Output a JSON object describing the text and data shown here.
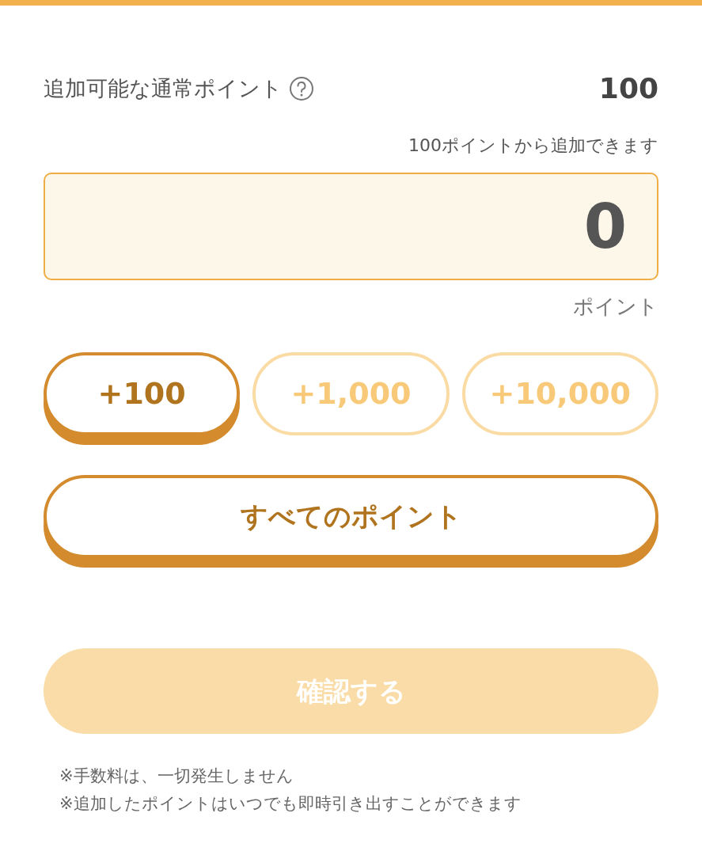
{
  "available": {
    "label": "追加可能な通常ポイント",
    "value": "100"
  },
  "hint": "100ポイントから追加できます",
  "amount": {
    "value": "0",
    "unit": "ポイント"
  },
  "increments": [
    {
      "label": "+100",
      "disabled": false
    },
    {
      "label": "+1,000",
      "disabled": true
    },
    {
      "label": "+10,000",
      "disabled": true
    }
  ],
  "all_points": {
    "label": "すべてのポイント",
    "disabled": false
  },
  "confirm": {
    "label": "確認する",
    "disabled": true
  },
  "notes": [
    "※手数料は、一切発生しません",
    "※追加したポイントはいつでも即時引き出すことができます"
  ]
}
